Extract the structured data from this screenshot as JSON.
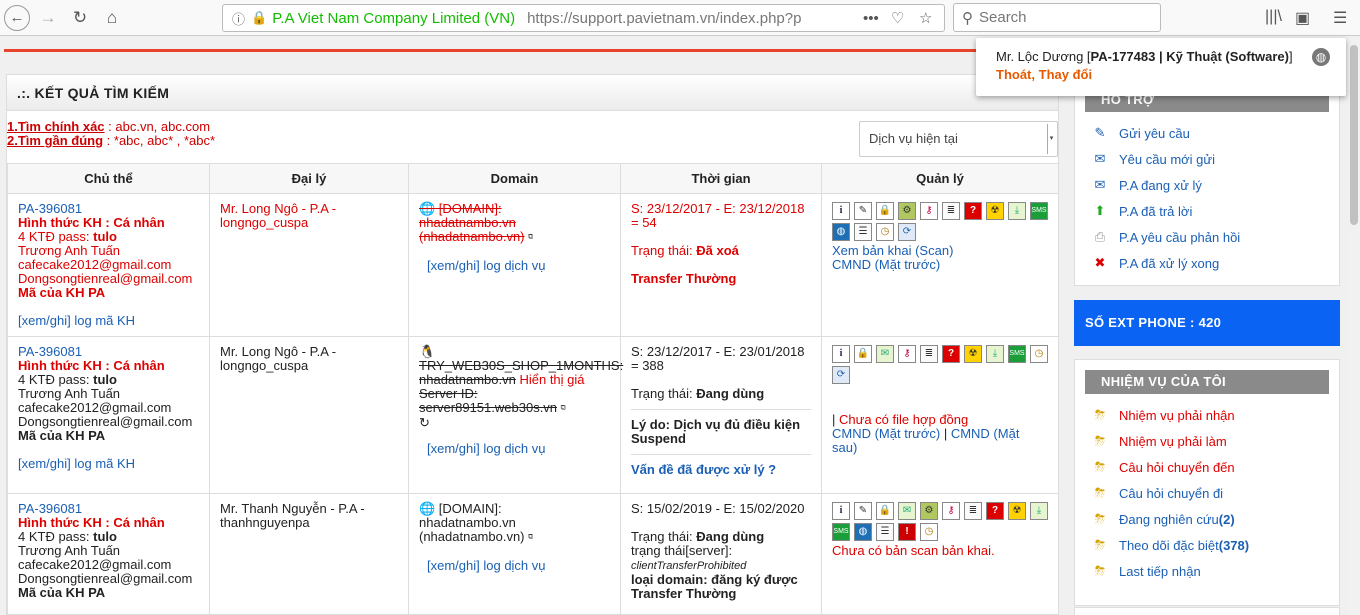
{
  "browser": {
    "org": "P.A Viet Nam Company Limited (VN)",
    "url": "https://support.pavietnam.vn/index.php?p",
    "search_placeholder": "Search"
  },
  "user_popup": {
    "prefix": "Mr. Lộc Dương [",
    "account": "PA-177483 | Kỹ Thuật (Software)",
    "suffix": "]",
    "logout": "Thoát",
    "comma": ", ",
    "change": "Thay đổi"
  },
  "results": {
    "title": ".:. KẾT QUẢ TÌM KIẾM",
    "hint1_key": "1.Tìm chính xác",
    "hint1_val": " : abc.vn, abc.com",
    "hint2_key": "2.Tìm gần đúng",
    "hint2_val": " : *abc, abc* , *abc*",
    "select_value": "Dịch vụ hiện tại",
    "columns": [
      "Chủ thể",
      "Đại lý",
      "Domain",
      "Thời gian",
      "Quản lý"
    ],
    "rows": [
      {
        "id": "PA-396081",
        "type": "Hình thức KH : Cá nhân",
        "pass_label": "4 KTĐ pass: ",
        "pass": "tulo",
        "name": "Trương Anh Tuấn",
        "email1": "cafecake2012@gmail.com",
        "email2": "Dongsongtienreal@gmail.com",
        "code": "Mã của KH PA",
        "log_link": "[xem/ghi] log mã KH",
        "agent_name": "Mr. Long Ngô - P.A -",
        "agent_user": "longngo_cuspa",
        "domain_l1": " [DOMAIN]:",
        "domain_l2": "nhadatnambo.vn",
        "domain_l3": "(nhadatnambo.vn)",
        "service_log": "[xem/ghi] log dịch vụ",
        "time": "S: 23/12/2017 - E: 23/12/2018 = 54",
        "status_label": "Trạng thái: ",
        "status": "Đã xoá",
        "transfer": "Transfer Thường",
        "manage_link1": "Xem bản khai (Scan)",
        "manage_link2": "CMND (Mặt trước)"
      },
      {
        "id": "PA-396081",
        "type": "Hình thức KH : Cá nhân",
        "pass_label": "4 KTĐ pass: ",
        "pass": "tulo",
        "name": "Trương Anh Tuấn",
        "email1": "cafecake2012@gmail.com",
        "email2": "Dongsongtienreal@gmail.com",
        "code": "Mã của KH PA",
        "log_link": "[xem/ghi] log mã KH",
        "agent_name": "Mr. Long Ngô - P.A -",
        "agent_user": "longngo_cuspa",
        "host_l1": "TRY_WEB30S_SHOP_1MONTHS:",
        "host_l2": "nhadatnambo.vn",
        "host_show": " Hiển thị giá",
        "host_l3": "Server ID:",
        "host_l4": "server89151.web30s.vn",
        "service_log": "[xem/ghi] log dịch vụ",
        "time": "S: 23/12/2017 - E: 23/01/2018 = 388",
        "status_label": "Trạng thái: ",
        "status": "Đang dùng",
        "reason": "Lý do: Dịch vụ đủ điều kiện Suspend",
        "resolved": "Vấn đề đã được xử lý ?",
        "manage_pre": "| ",
        "manage_red": "Chưa có file hợp đồng",
        "manage_link1": "CMND (Mặt trước)",
        "manage_sep": " | ",
        "manage_link2": "CMND (Mặt sau)"
      },
      {
        "id": "PA-396081",
        "type": "Hình thức KH : Cá nhân",
        "pass_label": "4 KTĐ pass: ",
        "pass": "tulo",
        "name": "Trương Anh Tuấn",
        "email1": "cafecake2012@gmail.com",
        "email2": "Dongsongtienreal@gmail.com",
        "code": "Mã của KH PA",
        "agent_name": "Mr. Thanh Nguyễn - P.A -",
        "agent_user": "thanhnguyenpa",
        "domain_l1": " [DOMAIN]:",
        "domain_l2": "nhadatnambo.vn",
        "domain_l3": "(nhadatnambo.vn)",
        "service_log": "[xem/ghi] log dịch vụ",
        "time": "S: 15/02/2019 - E: 15/02/2020",
        "status_label": "Trạng thái: ",
        "status": "Đang dùng",
        "server_status": "trạng thái[server]:",
        "server_status_val": "clientTransferProhibited",
        "domain_type": "loại domain: đăng ký được Transfer Thường",
        "manage_red": "Chưa có bản scan bản khai."
      }
    ]
  },
  "sidebar": {
    "support_title": "HỖ TRỢ",
    "support_items": [
      "Gửi yêu cầu",
      "Yêu cầu mới gửi",
      "P.A đang xử lý",
      "P.A đã trả lời",
      "P.A yêu cầu phản hồi",
      "P.A đã xử lý xong"
    ],
    "ext_phone": "SỐ EXT PHONE : 420",
    "tasks_title": "NHIỆM VỤ CỦA TÔI",
    "task_items": [
      {
        "label": "Nhiệm vụ phải nhận",
        "count": ""
      },
      {
        "label": "Nhiệm vụ phải làm",
        "count": ""
      },
      {
        "label": "Câu hỏi chuyển đến",
        "count": ""
      },
      {
        "label": "Câu hỏi chuyển đi",
        "count": ""
      },
      {
        "label": "Đang nghiên cứu ",
        "count": "(2)"
      },
      {
        "label": "Theo dõi đặc biệt ",
        "count": "(378)"
      },
      {
        "label": "Last tiếp nhận",
        "count": ""
      }
    ]
  }
}
